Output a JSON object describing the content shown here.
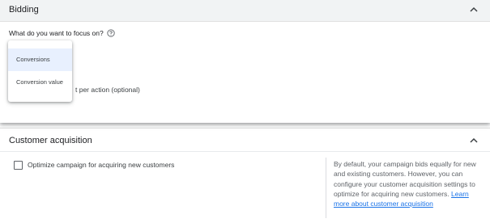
{
  "bidding": {
    "title": "Bidding",
    "focus_question": "What do you want to focus on?",
    "target_label_partial": "t per action (optional)",
    "menu": {
      "options": [
        "Conversions",
        "Conversion value"
      ],
      "selected": "Conversions"
    },
    "icons": {
      "collapse": "chevron-up-icon",
      "help": "help-circle-icon"
    }
  },
  "customer_acquisition": {
    "title": "Customer acquisition",
    "checkbox_label": "Optimize campaign for acquiring new customers",
    "checkbox_checked": false,
    "help_text": "By default, your campaign bids equally for new and existing customers. However, you can configure your customer acquisition settings to optimize for acquiring new customers.",
    "help_link": "Learn more about customer acquisition",
    "icons": {
      "collapse": "chevron-up-icon"
    }
  },
  "colors": {
    "header_bg": "#f1f3f4",
    "selected_bg": "#e8f0fe",
    "link": "#1a73e8",
    "text": "#3c4043"
  }
}
